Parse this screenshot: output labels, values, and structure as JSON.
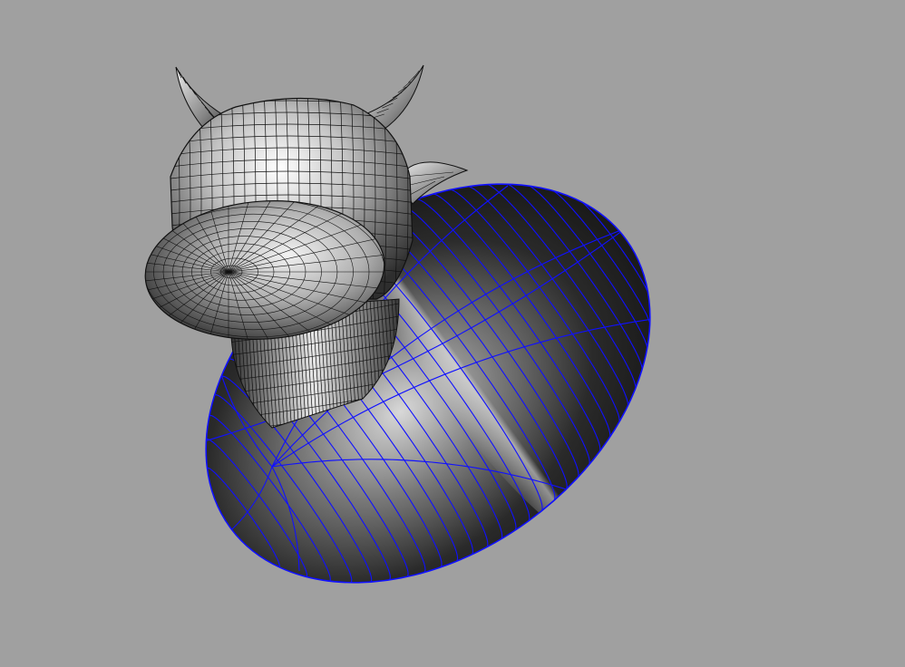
{
  "viewport": {
    "background_color": "#a0a0a0",
    "wireframe_color": "#1010ff",
    "head_wire_color": "#111111"
  },
  "scene": {
    "objects": [
      {
        "name": "body",
        "kind": "ellipsoid-surface",
        "selected": true
      },
      {
        "name": "head",
        "kind": "surface"
      },
      {
        "name": "snout",
        "kind": "ellipsoid-surface"
      },
      {
        "name": "neck",
        "kind": "surface"
      },
      {
        "name": "horn-left",
        "kind": "cone-surface"
      },
      {
        "name": "horn-right",
        "kind": "cone-surface"
      },
      {
        "name": "ear-left",
        "kind": "surface"
      },
      {
        "name": "ear-right",
        "kind": "surface"
      }
    ]
  }
}
